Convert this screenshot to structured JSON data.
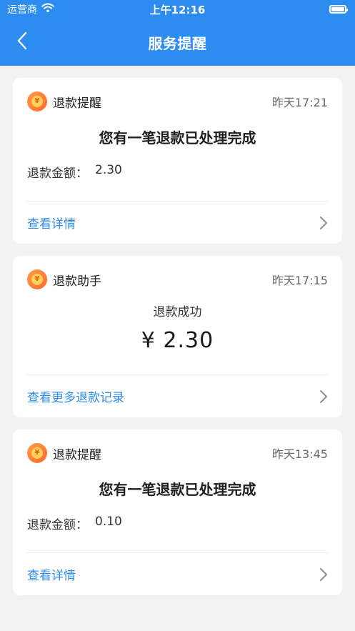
{
  "status_bar": {
    "carrier": "运营商",
    "time": "上午12:16"
  },
  "nav": {
    "title": "服务提醒"
  },
  "cards": [
    {
      "title": "退款提醒",
      "time": "昨天17:21",
      "headline": "您有一笔退款已处理完成",
      "amount_label": "退款金额：",
      "amount_value": "2.30",
      "link": "查看详情"
    },
    {
      "title": "退款助手",
      "time": "昨天17:15",
      "status": "退款成功",
      "amount": "¥ 2.30",
      "link": "查看更多退款记录"
    },
    {
      "title": "退款提醒",
      "time": "昨天13:45",
      "headline": "您有一笔退款已处理完成",
      "amount_label": "退款金额：",
      "amount_value": "0.10",
      "link": "查看详情"
    }
  ],
  "icons": {
    "back": "back-chevron-icon",
    "coin": "refund-coin-icon",
    "chevron": "chevron-right-icon",
    "wifi": "wifi-icon",
    "battery": "battery-icon"
  },
  "colors": {
    "brand": "#2d8cf0",
    "background": "#f2f2f2",
    "coin": "#ff6a2b"
  }
}
